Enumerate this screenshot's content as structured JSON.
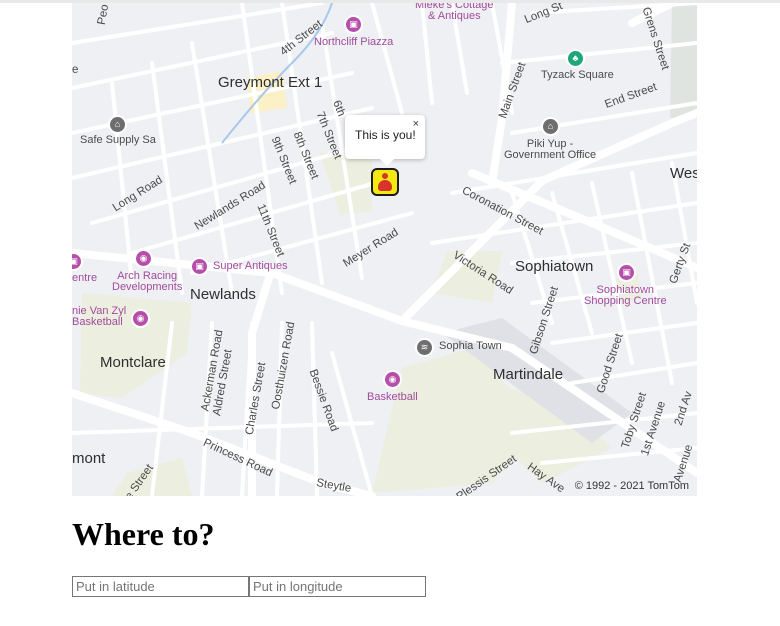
{
  "map": {
    "popup": {
      "text": "This is you!",
      "close_glyph": "×"
    },
    "copyright": "© 1992 - 2021 TomTom",
    "labels": {
      "mieke": "Mieke's Cottage\n& Antiques",
      "northcliff": "Northcliff Piazza",
      "greymont": "Greymont Ext 1",
      "tyzack": "Tyzack Square",
      "piki": "Piki Yup -\nGovernment Office",
      "safe_supply": "Safe Supply Sa",
      "wes": "Wes",
      "arch_racing": "Arch Racing\nDevelopments",
      "super_antiques": "Super Antiques",
      "entre": "entre",
      "newlands": "Newlands",
      "van_zyl": "nie Van Zyl\nBasketball",
      "sophiatown": "Sophiatown",
      "sophiatown_sc": "Sophiatown\nShopping Centre",
      "montclare": "Montclare",
      "sophia_town": "Sophia Town",
      "martindale": "Martindale",
      "basketball": "Basketball",
      "mont": "mont"
    },
    "streets": {
      "fourth": "4th Street",
      "sixth": "6th",
      "seventh": "7th Street",
      "eighth": "8th Street",
      "ninth": "9th Street",
      "eleventh": "11th Street",
      "newlands_rd": "Newlands Road",
      "long_rd": "Long Road",
      "meyer": "Meyer Road",
      "coronation": "Coronation Street",
      "victoria": "Victoria Road",
      "main": "Main Street",
      "end": "End Street",
      "long_st": "Long St",
      "grens": "Grens Street",
      "gerty": "Gerty St",
      "gibson": "Gibson Street",
      "good": "Good Street",
      "toby": "Toby Street",
      "first_ave": "1st Avenue",
      "second_ave": "2nd Av",
      "avenue": "Avenue",
      "ackerman": "Ackerman Road",
      "aldred": "Aldred Street",
      "charles": "Charles Street",
      "oosthuizen": "Oosthuizen Road",
      "bessie": "Bessie Road",
      "princess": "Princess Road",
      "steytle": "Steytle",
      "plessis": "Plessis Street",
      "hay": "Hay Ave",
      "street_bl": "e Street",
      "peo": "Peo",
      "e_top": "e"
    },
    "pois": [
      {
        "name": "northcliff-piazza",
        "icon": "shopping-bag-icon"
      },
      {
        "name": "tyzack-square",
        "icon": "park-icon"
      },
      {
        "name": "piki-yup",
        "icon": "government-icon"
      },
      {
        "name": "safe-supply",
        "icon": "store-icon"
      },
      {
        "name": "arch-racing",
        "icon": "sports-icon"
      },
      {
        "name": "super-antiques",
        "icon": "shopping-bag-icon"
      },
      {
        "name": "van-zyl-basketball",
        "icon": "sports-icon"
      },
      {
        "name": "sophiatown-shopping-centre",
        "icon": "shopping-bag-icon"
      },
      {
        "name": "sophia-town",
        "icon": "landmark-icon"
      },
      {
        "name": "basketball",
        "icon": "sports-icon"
      }
    ]
  },
  "heading": "Where to?",
  "inputs": {
    "latitude": {
      "value": "",
      "placeholder": "Put in latitude"
    },
    "longitude": {
      "value": "",
      "placeholder": "Put in longitude"
    }
  },
  "colors": {
    "background": "#eef0f3",
    "road": "#ffffff",
    "park": "#eceedf",
    "poi_accent": "#b64fa9",
    "marker": "#f3e80f"
  }
}
